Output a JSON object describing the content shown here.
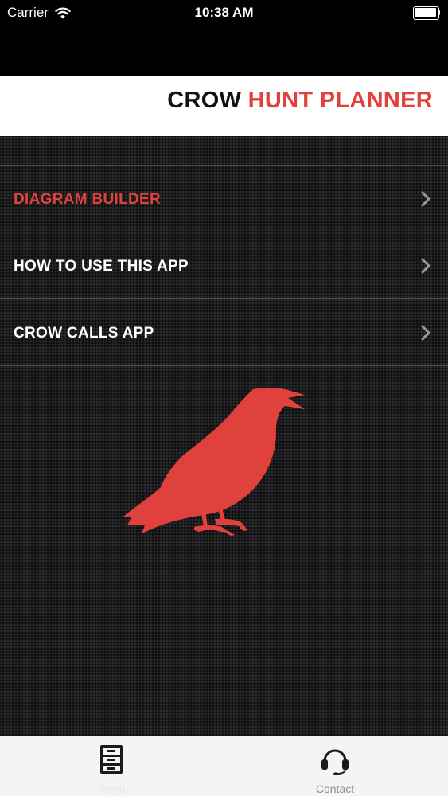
{
  "status_bar": {
    "carrier": "Carrier",
    "time": "10:38 AM",
    "wifi_icon": "wifi-icon",
    "battery_icon": "battery-icon",
    "battery_level": 1.0
  },
  "header": {
    "title_part1": "CROW ",
    "title_part2": "HUNT PLANNER"
  },
  "menu": {
    "items": [
      {
        "label": "DIAGRAM BUILDER",
        "active": true,
        "icon": "chevron-right-icon"
      },
      {
        "label": "HOW TO USE THIS APP",
        "active": false,
        "icon": "chevron-right-icon"
      },
      {
        "label": "CROW CALLS APP",
        "active": false,
        "icon": "chevron-right-icon"
      }
    ]
  },
  "illustration": {
    "icon": "crow-icon",
    "color": "#e0413d"
  },
  "tab_bar": {
    "tabs": [
      {
        "label": "Menu",
        "icon": "filing-cabinet-icon",
        "selected": true
      },
      {
        "label": "Contact",
        "icon": "headset-icon",
        "selected": false
      }
    ]
  },
  "colors": {
    "accent": "#e0413d",
    "background": "#1c1c1e",
    "header_bg": "#ffffff",
    "tab_bar_bg": "#f4f4f4"
  }
}
